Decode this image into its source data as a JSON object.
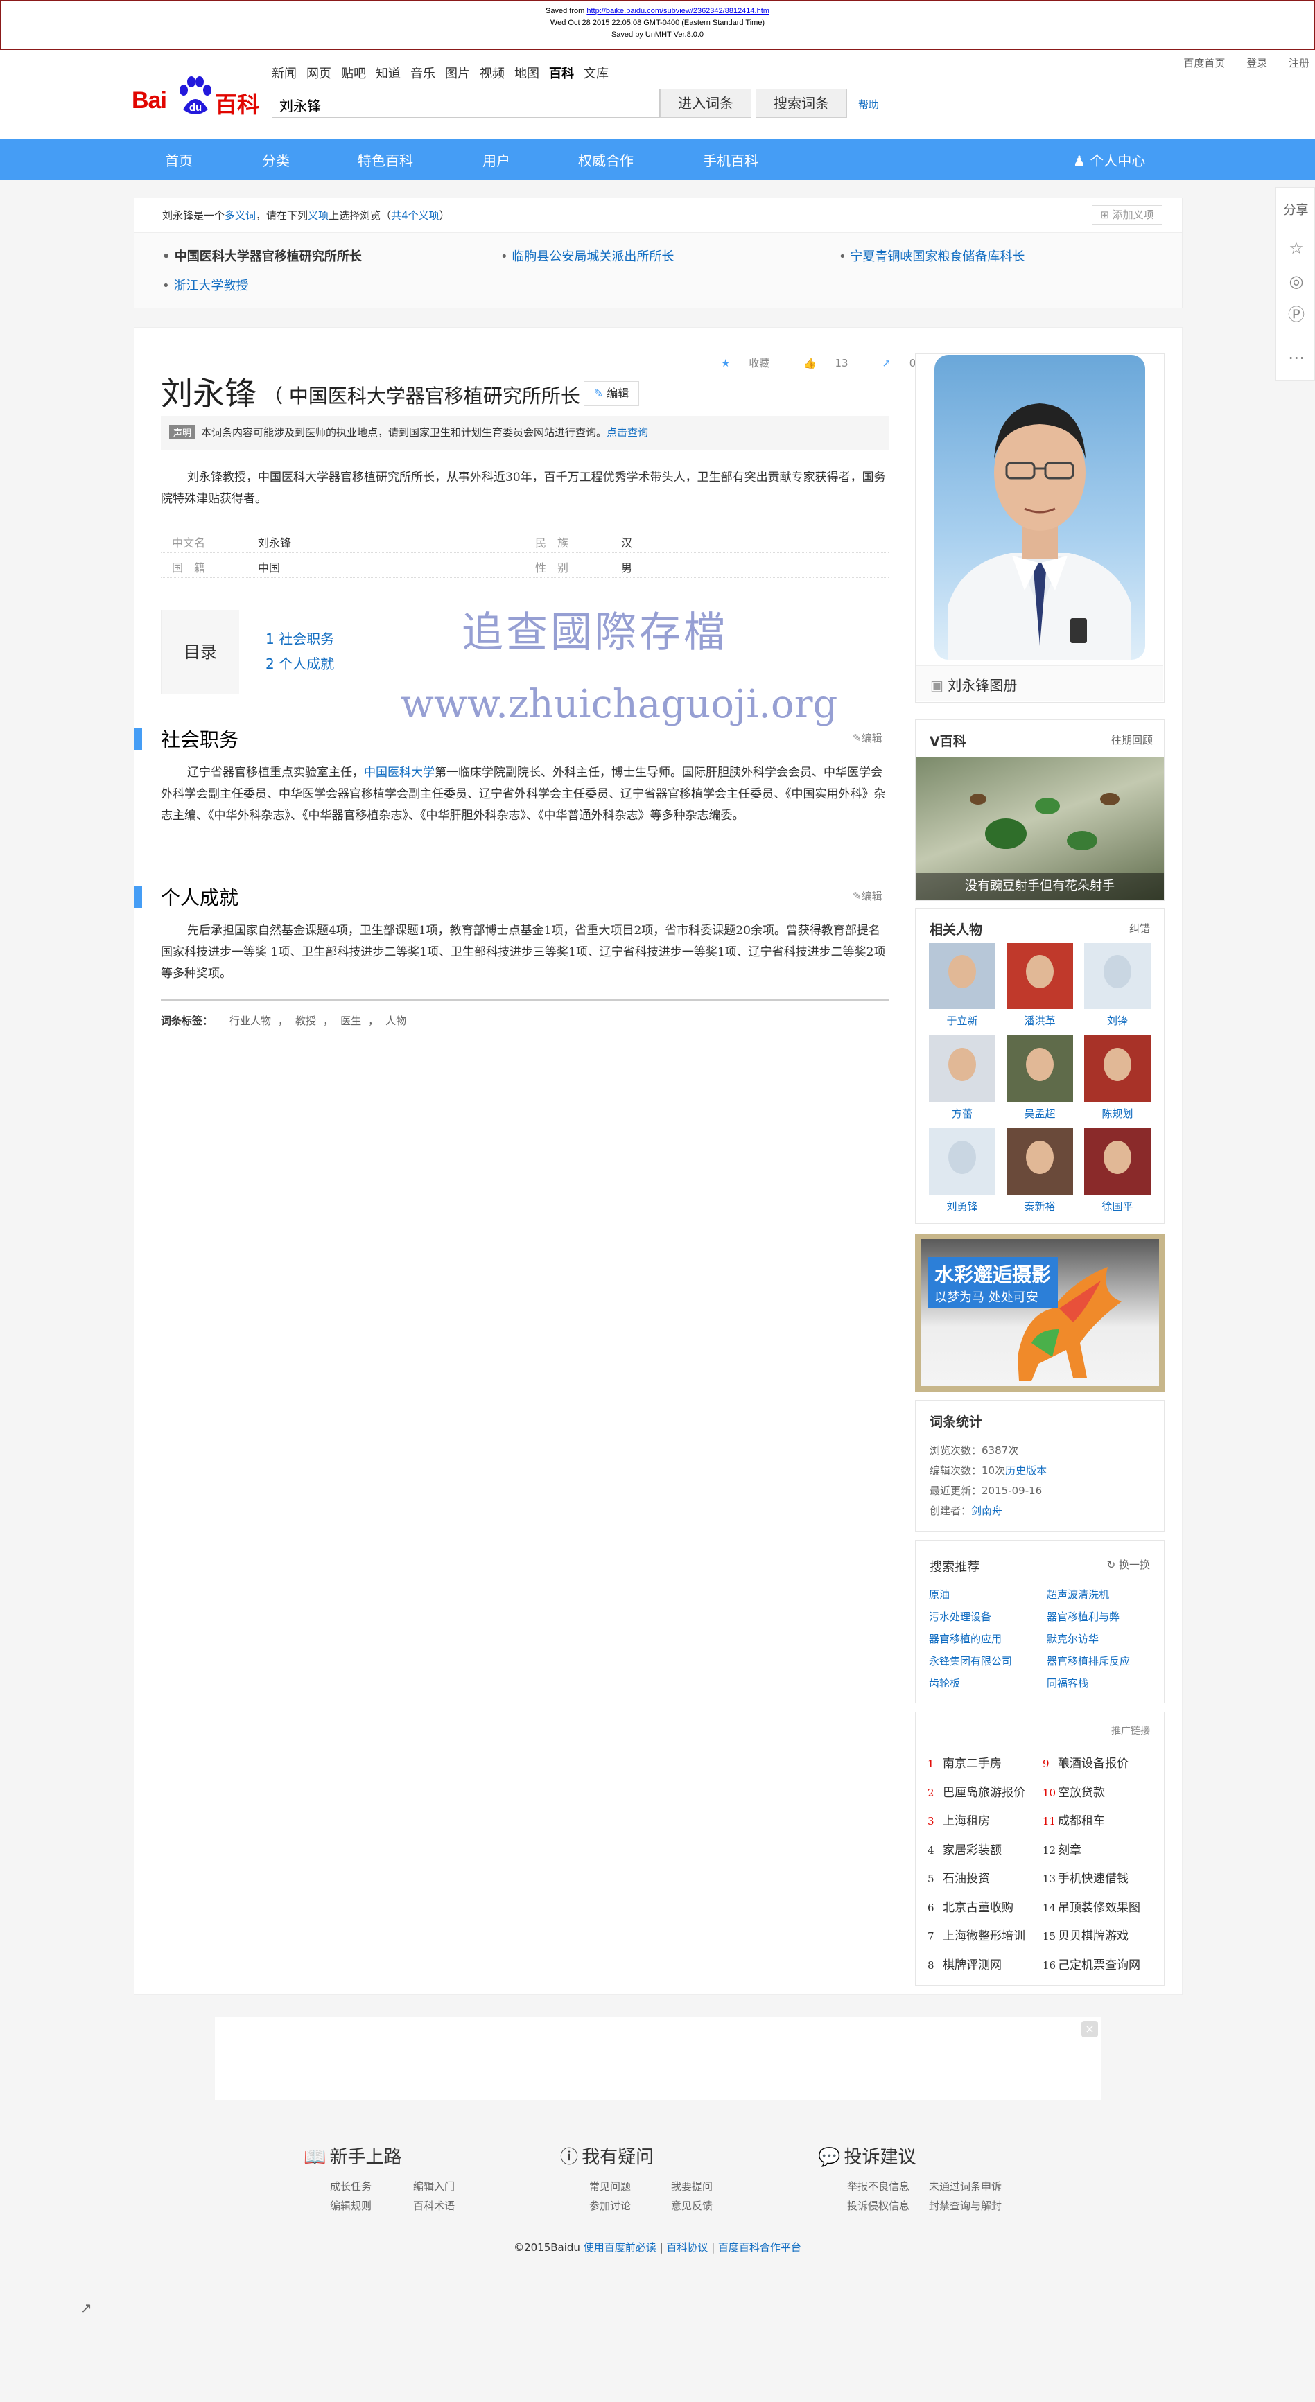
{
  "saved": {
    "line1_prefix": "Saved from",
    "url": "http://baike.baidu.com/subview/2362342/8812414.htm",
    "line2": "Wed Oct 28 2015 22:05:08 GMT-0400 (Eastern Standard Time)",
    "line3": "Saved by UnMHT Ver.8.0.0"
  },
  "toplinks": [
    "百度首页",
    "登录",
    "注册"
  ],
  "logo": {
    "bai": "Bai",
    "du": "du",
    "baike": "百科"
  },
  "nav": [
    "新闻",
    "网页",
    "贴吧",
    "知道",
    "音乐",
    "图片",
    "视频",
    "地图",
    "百科",
    "文库"
  ],
  "search": {
    "value": "刘永锋",
    "enter_label": "进入词条",
    "search_label": "搜索词条",
    "help_label": "帮助"
  },
  "bluenav": {
    "items": [
      "首页",
      "分类",
      "特色百科",
      "用户",
      "权威合作",
      "手机百科"
    ],
    "user_center": "个人中心"
  },
  "share": {
    "label": "分享"
  },
  "polysemy": {
    "head_a": "刘永锋",
    "head_b": "是一个",
    "head_link": "多义词",
    "head_c": "，请在下列",
    "head_link2": "义项",
    "head_d": "上选择浏览（",
    "head_count": "共4个义项",
    "head_e": "）",
    "add_label": "添加义项",
    "items": [
      "中国医科大学器官移植研究所所长",
      "临朐县公安局城关派出所所长",
      "宁夏青铜峡国家粮食储备库科长",
      "浙江大学教授"
    ]
  },
  "entry": {
    "title": "刘永锋",
    "subtitle": "（ 中国医科大学器官移植研究所所长 ）",
    "edit_label": "编辑",
    "collect_label": "收藏",
    "like_count": "13",
    "share_count": "0",
    "notice_tag": "声明",
    "notice_text": "本词条内容可能涉及到医师的执业地点，请到国家卫生和计划生育委员会网站进行查询。",
    "notice_link": "点击查询",
    "summary": "刘永锋教授，中国医科大学器官移植研究所所长，从事外科近30年，百千万工程优秀学术带头人，卫生部有突出贡献专家获得者，国务院特殊津贴获得者。",
    "basic": [
      {
        "k": "中文名",
        "v": "刘永锋"
      },
      {
        "k": "民　族",
        "v": "汉"
      },
      {
        "k": "国　籍",
        "v": "中国"
      },
      {
        "k": "性　别",
        "v": "男"
      }
    ],
    "toc_label": "目录",
    "toc": [
      "1  社会职务",
      "2  个人成就"
    ],
    "watermark_cn": "追查國際存檔",
    "watermark_url": "www.zhuichaguoji.org",
    "sections": [
      {
        "title": "社会职务",
        "edit": "编辑",
        "text_a": "辽宁省器官移植重点实验室主任，",
        "link": "中国医科大学",
        "text_b": "第一临床学院副院长、外科主任，博士生导师。国际肝胆胰外科学会会员、中华医学会外科学会副主任委员、中华医学会器官移植学会副主任委员、辽宁省外科学会主任委员、辽宁省器官移植学会主任委员、《中国实用外科》杂志主编、《中华外科杂志》、《中华器官移植杂志》、《中华肝胆外科杂志》、《中华普通外科杂志》等多种杂志编委。"
      },
      {
        "title": "个人成就",
        "edit": "编辑",
        "text": "先后承担国家自然基金课题4项，卫生部课题1项，教育部博士点基金1项，省重大项目2项，省市科委课题20余项。曾获得教育部提名国家科技进步一等奖 1项、卫生部科技进步二等奖1项、卫生部科技进步三等奖1项、辽宁省科技进步一等奖1项、辽宁省科技进步二等奖2项等多种奖项。"
      }
    ],
    "tags_label": "词条标签：",
    "tags": [
      "行业人物",
      "，",
      "教授",
      "，",
      "医生",
      "，",
      "人物"
    ]
  },
  "right": {
    "album_label": "刘永锋图册",
    "vbaike": {
      "title": "V百科",
      "more": "往期回顾",
      "caption": "没有豌豆射手但有花朵射手"
    },
    "related": {
      "title": "相关人物",
      "action": "纠错",
      "people": [
        "于立新",
        "潘洪革",
        "刘锋",
        "方蕾",
        "吴孟超",
        "陈规划",
        "刘勇锋",
        "秦新裕",
        "徐国平"
      ]
    },
    "ad": {
      "line1": "水彩邂逅摄影",
      "line2": "以梦为马 处处可安"
    },
    "stats": {
      "title": "词条统计",
      "views_label": "浏览次数：",
      "views": "6387次",
      "edits_label": "编辑次数：",
      "edits": "10次",
      "history": "历史版本",
      "updated_label": "最近更新：",
      "updated": "2015-09-16",
      "creator_label": "创建者：",
      "creator": "剑南舟"
    },
    "recommend": {
      "title": "搜索推荐",
      "refresh": "换一换",
      "items": [
        "原油",
        "超声波清洗机",
        "污水处理设备",
        "器官移植利与弊",
        "器官移植的应用",
        "默克尔访华",
        "永锋集团有限公司",
        "器官移植排斥反应",
        "齿轮板",
        "同福客栈"
      ]
    },
    "promo": {
      "label": "推广链接",
      "items": [
        {
          "n": "1",
          "t": "南京二手房"
        },
        {
          "n": "9",
          "t": "酿酒设备报价"
        },
        {
          "n": "2",
          "t": "巴厘岛旅游报价"
        },
        {
          "n": "10",
          "t": "空放贷款"
        },
        {
          "n": "3",
          "t": "上海租房"
        },
        {
          "n": "11",
          "t": "成都租车"
        },
        {
          "n": "4",
          "t": "家居彩装额"
        },
        {
          "n": "12",
          "t": "刻章"
        },
        {
          "n": "5",
          "t": "石油投资"
        },
        {
          "n": "13",
          "t": "手机快速借钱"
        },
        {
          "n": "6",
          "t": "北京古董收购"
        },
        {
          "n": "14",
          "t": "吊顶装修效果图"
        },
        {
          "n": "7",
          "t": "上海微整形培训"
        },
        {
          "n": "15",
          "t": "贝贝棋牌游戏"
        },
        {
          "n": "8",
          "t": "棋牌评测网"
        },
        {
          "n": "16",
          "t": "己定机票查询网"
        }
      ]
    }
  },
  "footer": {
    "cols": [
      {
        "title": "新手上路",
        "links": [
          "成长任务",
          "编辑入门",
          "编辑规则",
          "百科术语"
        ]
      },
      {
        "title": "我有疑问",
        "links": [
          "常见问题",
          "我要提问",
          "参加讨论",
          "意见反馈"
        ]
      },
      {
        "title": "投诉建议",
        "links": [
          "举报不良信息",
          "未通过词条申诉",
          "投诉侵权信息",
          "封禁查询与解封"
        ]
      }
    ],
    "copyright": "©2015Baidu",
    "links": [
      "使用百度前必读",
      "百科协议",
      "百度百科合作平台"
    ]
  },
  "colors": {
    "accent": "#459df5",
    "link": "#136ec2",
    "brand_red": "#e10601",
    "banner_border": "#8b1a1a"
  }
}
